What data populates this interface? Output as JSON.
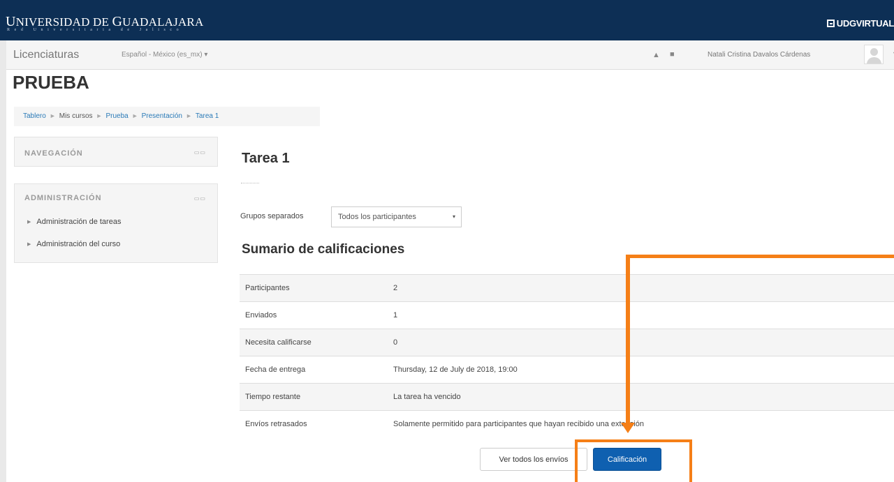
{
  "header": {
    "university_first_letter": "U",
    "university_name_rest": "NIVERSIDAD DE ",
    "university_g": "G",
    "university_name_end": "UADALAJARA",
    "university_subtitle": "Red Universitaria de Jalisco",
    "brand_right": "UDGVIRTUAL"
  },
  "navbar": {
    "site_name": "Licenciaturas",
    "language": "Español - México (es_mx) ▾",
    "user_name": "Natali Cristina Davalos Cárdenas",
    "user_menu_caret": "▾"
  },
  "page": {
    "title": "PRUEBA"
  },
  "breadcrumb": {
    "items": [
      "Tablero",
      "Mis cursos",
      "Prueba",
      "Presentación",
      "Tarea 1"
    ],
    "separator": "►"
  },
  "blocks": {
    "navigation": {
      "title": "NAVEGACIÓN"
    },
    "administration": {
      "title": "ADMINISTRACIÓN",
      "items": [
        "Administración de tareas",
        "Administración del curso"
      ]
    }
  },
  "main": {
    "heading": "Tarea 1",
    "groups_label": "Grupos separados",
    "groups_value": "Todos los participantes",
    "summary_heading": "Sumario de calificaciones",
    "summary_rows": [
      {
        "label": "Participantes",
        "value": "2"
      },
      {
        "label": "Enviados",
        "value": "1"
      },
      {
        "label": "Necesita calificarse",
        "value": "0"
      },
      {
        "label": "Fecha de entrega",
        "value": "Thursday, 12 de July de 2018, 19:00"
      },
      {
        "label": "Tiempo restante",
        "value": "La tarea ha vencido"
      },
      {
        "label": "Envíos retrasados",
        "value": "Solamente permitido para participantes que hayan recibido una extensión"
      }
    ],
    "view_all_button": "Ver todos los envíos",
    "grade_button": "Calificación"
  },
  "colors": {
    "topbar": "#0d2f55",
    "link": "#2a7ab7",
    "primary_button": "#0f60b0",
    "annotation": "#f57f17"
  },
  "icons": {
    "block_controls": "▭▭",
    "tree_arrow": "▶",
    "select_caret": "▾"
  }
}
